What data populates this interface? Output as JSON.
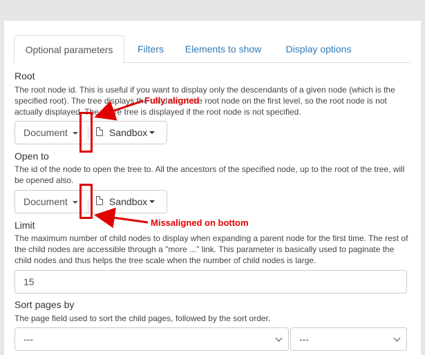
{
  "tabs": [
    {
      "label": "Optional parameters"
    },
    {
      "label": "Filters"
    },
    {
      "label": "Elements to show"
    },
    {
      "label": "Display options"
    }
  ],
  "root": {
    "label": "Root",
    "help": "The root node id. This is useful if you want to display only the descendants of a given node (which is the specified root). The tree displays the children of the root node on the first level, so the root node is not actually displayed. The entire tree is displayed if the root node is not specified.",
    "doc_label": "Document",
    "space_label": "Sandbox"
  },
  "open_to": {
    "label": "Open to",
    "help": "The id of the node to open the tree to. All the ancestors of the specified node, up to the root of the tree, will be opened also.",
    "doc_label": "Document",
    "space_label": "Sandbox"
  },
  "limit": {
    "label": "Limit",
    "help": "The maximum number of child nodes to display when expanding a parent node for the first time. The rest of the child nodes are accessible through a \"more ...\" link. This parameter is basically used to paginate the child nodes and thus helps the tree scale when the number of child nodes is large.",
    "value": "15"
  },
  "sort": {
    "label": "Sort pages by",
    "help": "The page field used to sort the child pages, followed by the sort order.",
    "field_value": "---",
    "order_value": "---"
  },
  "annotations": {
    "aligned": "Fully aligned",
    "misaligned": "Missaligned on bottom",
    "color": "#e00000"
  }
}
